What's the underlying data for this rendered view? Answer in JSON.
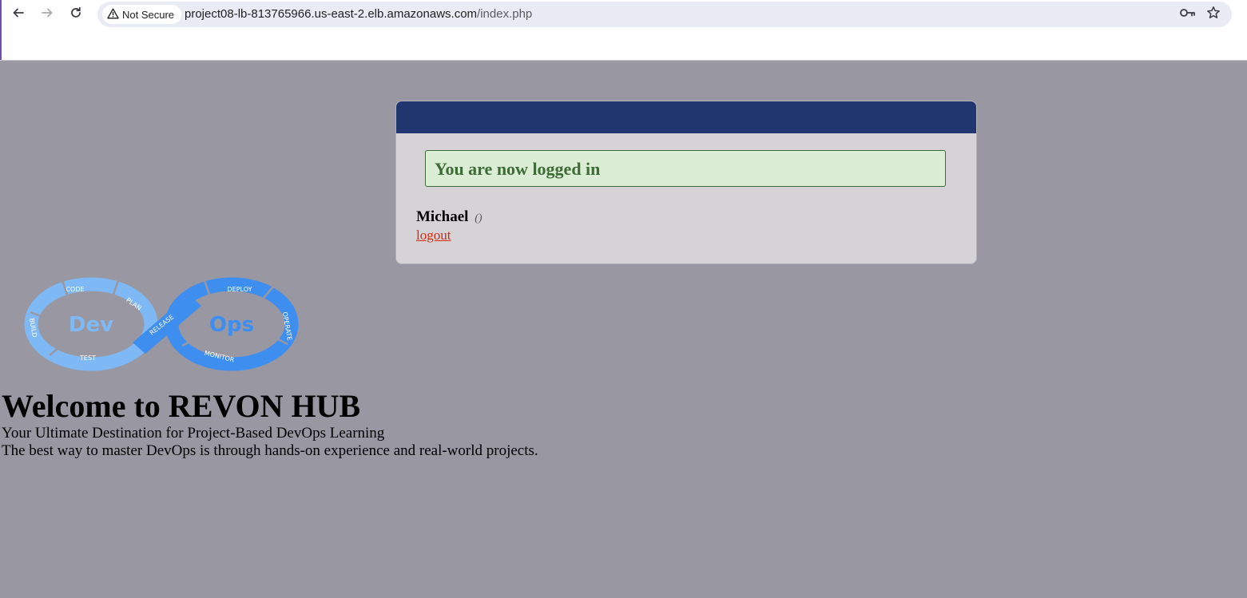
{
  "browser": {
    "security_label": "Not Secure",
    "url_host": "project08-lb-813765966.us-east-2.elb.amazonaws.com",
    "url_path": "/index.php",
    "icons": [
      "back-arrow-icon",
      "forward-arrow-icon",
      "reload-icon",
      "warning-icon",
      "key-icon",
      "star-icon"
    ]
  },
  "card": {
    "header_color": "#21356f",
    "success_message": "You are now logged in",
    "username": "Michael",
    "role": "()",
    "logout_label": "logout"
  },
  "logo": {
    "left_word": "Dev",
    "right_word": "Ops",
    "stages": {
      "code": "CODE",
      "plan": "PLAN",
      "build": "BUILD",
      "test": "TEST",
      "release": "RELEASE",
      "deploy": "DEPLOY",
      "operate": "OPERATE",
      "monitor": "MONITOR"
    }
  },
  "main": {
    "title": "Welcome to REVON HUB",
    "tagline": "Your Ultimate Destination for Project-Based DevOps Learning",
    "description": "The best way to master DevOps is through hands-on experience and real-world projects."
  },
  "colors": {
    "page_background": "#9897a2",
    "success_text": "#3d6c37",
    "success_background": "#dcedd5",
    "logout_link": "#d62a0f",
    "logo_light_blue": "#7fb9f5",
    "logo_blue": "#3e8ef0"
  }
}
